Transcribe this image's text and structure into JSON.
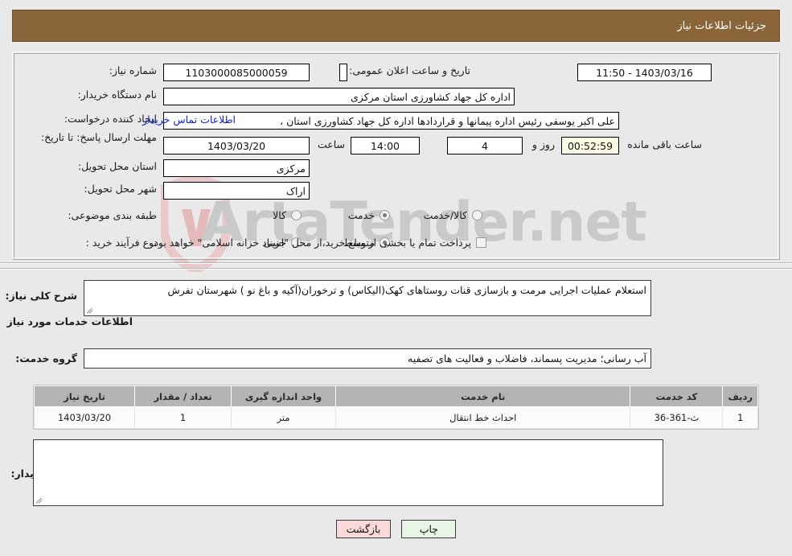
{
  "header": {
    "title": "جزئیات اطلاعات نیاز"
  },
  "watermark": {
    "text": "ArtaTender.net",
    "shield_color": "#e5c2c2",
    "text_color": "#c9c9c9"
  },
  "form": {
    "need_number_label": "شماره نیاز:",
    "need_number_value": "1103000085000059",
    "announce_label": "تاریخ و ساعت اعلان عمومی:",
    "announce_value": "1403/03/16 - 11:50",
    "buyer_org_label": "نام دستگاه خریدار:",
    "buyer_org_value": "اداره کل جهاد کشاورزی استان مرکزی",
    "requester_label": "ایجاد کننده درخواست:",
    "requester_value": "علی اکبر یوسفی رئیس اداره پیمانها و قراردادها اداره کل جهاد کشاورزی استان ،",
    "requester_link": "اطلاعات تماس خریدار",
    "deadline_label": "مهلت ارسال پاسخ: تا تاریخ:",
    "deadline_date": "1403/03/20",
    "deadline_hour_label": "ساعت",
    "deadline_hour": "14:00",
    "remaining_days": "4",
    "remaining_days_label": "روز و",
    "remaining_timer": "00:52:59",
    "remaining_suffix": "ساعت باقی مانده",
    "province_label": "استان محل تحویل:",
    "province_value": "مرکزی",
    "city_label": "شهر محل تحویل:",
    "city_value": "اراک",
    "category_label": "طبقه بندی موضوعی:",
    "category_options": [
      {
        "label": "کالا",
        "selected": false
      },
      {
        "label": "خدمت",
        "selected": true
      },
      {
        "label": "کالا/خدمت",
        "selected": false
      }
    ],
    "process_label": "نوع فرآیند خرید :",
    "process_options": [
      {
        "label": "جزیی",
        "selected": false
      },
      {
        "label": "متوسط",
        "selected": true
      }
    ],
    "treasury_checkbox_label": "پرداخت تمام یا بخشی از مبلغ خرید،از محل \"اسناد خزانه اسلامی\" خواهد بود.",
    "treasury_checked": false
  },
  "description": {
    "label": "شرح کلی نیاز:",
    "value": "استعلام عملیات اجرایی مرمت و بازسازی قنات روستاهای کهک(الیکاس) و ترخوران(آکیه و باغ نو )  شهرستان تفرش"
  },
  "services_section": {
    "title": "اطلاعات خدمات مورد نیاز",
    "group_label": "گروه خدمت:",
    "group_value": "آب رسانی؛ مدیریت پسماند، فاضلاب و فعالیت های تصفیه"
  },
  "table": {
    "columns": [
      "ردیف",
      "کد خدمت",
      "نام خدمت",
      "واحد اندازه گیری",
      "تعداد / مقدار",
      "تاریخ نیاز"
    ],
    "rows": [
      {
        "index": "1",
        "code": "ث-361-36",
        "name": "احداث خط انتقال",
        "unit": "متر",
        "quantity": "1",
        "need_date": "1403/03/20"
      }
    ]
  },
  "buyer_notes": {
    "label": "توضیحات خریدار:",
    "value": ""
  },
  "buttons": {
    "print": "چاپ",
    "back": "بازگشت"
  }
}
